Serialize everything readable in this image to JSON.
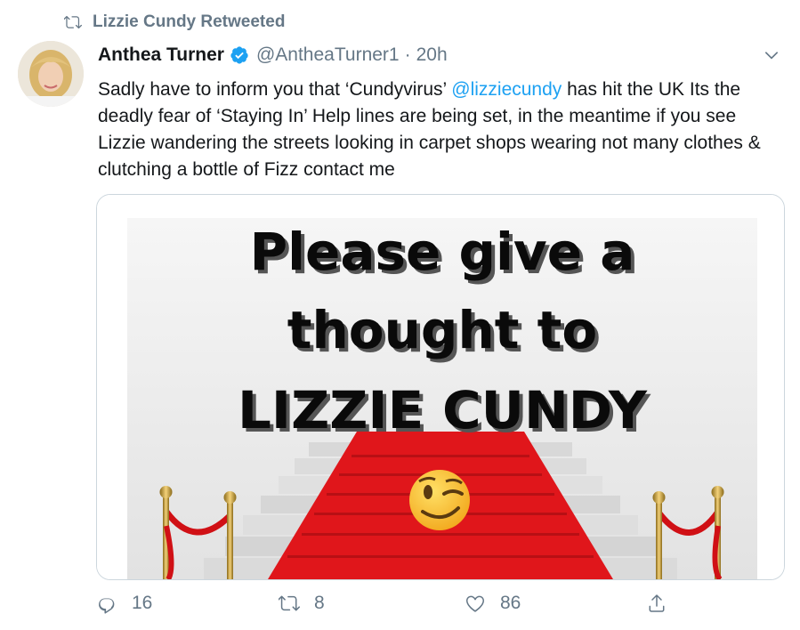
{
  "retweeted_by": "Lizzie Cundy Retweeted",
  "author": {
    "name": "Anthea Turner",
    "handle": "@AntheaTurner1",
    "time": "20h",
    "separator": "·"
  },
  "text": {
    "before": "Sadly have to inform you that ‘Cundyvirus’ ",
    "mention": "@lizziecundy",
    "after": " has hit the UK Its the deadly fear of ‘Staying In’ Help lines are being set, in the meantime if you see Lizzie wandering the streets looking in carpet shops wearing not many clothes &  clutching a bottle of Fizz contact me"
  },
  "image_text": {
    "line1": "Please give a",
    "line2": "thought to",
    "line3": "LIZZIE CUNDY"
  },
  "counts": {
    "replies": "16",
    "retweets": "8",
    "likes": "86"
  },
  "icons": [
    "retweet-icon",
    "verified-badge-icon",
    "chevron-down-icon",
    "reply-icon",
    "retweet-icon",
    "like-icon",
    "share-icon",
    "wink-emoji"
  ],
  "colors": {
    "accent": "#1da1f2",
    "muted": "#657786",
    "carpet": "#e0161b"
  }
}
